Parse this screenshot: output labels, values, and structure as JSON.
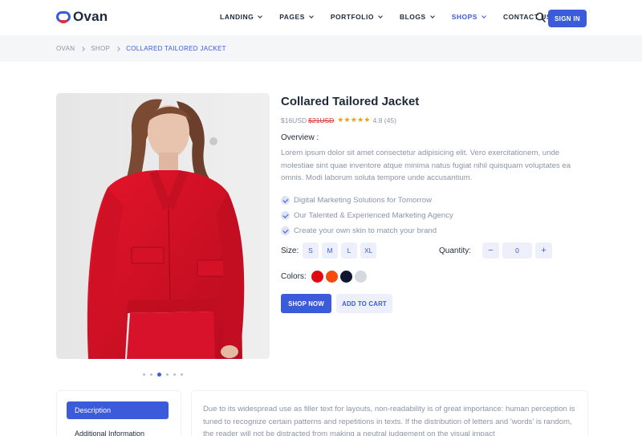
{
  "brand": {
    "name": "Ovan"
  },
  "nav": {
    "items": [
      {
        "label": "LANDING",
        "dropdown": true
      },
      {
        "label": "PAGES",
        "dropdown": true
      },
      {
        "label": "PORTFOLIO",
        "dropdown": true
      },
      {
        "label": "BLOGS",
        "dropdown": true
      },
      {
        "label": "SHOPS",
        "dropdown": true,
        "active": true
      },
      {
        "label": "CONTACT US",
        "dropdown": false
      }
    ],
    "search_icon": "search-icon",
    "signin_label": "SIGN IN"
  },
  "breadcrumb": {
    "items": [
      "OVAN",
      "SHOP"
    ],
    "current": "COLLARED TAILORED JACKET"
  },
  "product": {
    "title": "Collared Tailored Jacket",
    "price": "$16USD",
    "old_price": "$21USD",
    "stars": "★★★★★",
    "rating": "4.8 (45)",
    "overview_heading": "Overview :",
    "overview_text": "Lorem ipsum dolor sit amet consectetur adipisicing elit. Vero exercitationem, unde molestiae sint quae inventore atque minima natus fugiat nihil quisquam voluptates ea omnis. Modi laborum soluta tempore unde accusantium.",
    "features": [
      "Digital Marketing Solutions for Tomorrow",
      "Our Talented & Experienced Marketing Agency",
      "Create your own skin to match your brand"
    ],
    "size_label": "Size:",
    "sizes": [
      "S",
      "M",
      "L",
      "XL"
    ],
    "quantity_label": "Quantity:",
    "quantity": {
      "minus": "−",
      "value": "0",
      "plus": "+"
    },
    "colors_label": "Colors:",
    "colors": [
      "#e00b10",
      "#f44c0e",
      "#0f1730",
      "#d5d8de"
    ],
    "shop_now_label": "SHOP NOW",
    "add_to_cart_label": "ADD TO CART",
    "carousel": {
      "slides": 6,
      "active": 3
    }
  },
  "tabs": {
    "items": [
      "Description",
      "Additional Information"
    ],
    "active": "Description"
  },
  "description": {
    "text": "Due to its widespread use as filler text for layouts, non-readability is of great importance: human perception is tuned to recognize certain patterns and repetitions in texts. If the distribution of letters and 'words' is random, the reader will not be distracted from making a neutral judgement on the visual impact"
  },
  "colors": {
    "accent": "#3b5bdb",
    "accent_light": "#edf0fb",
    "muted_text": "#8b95a5",
    "breadcrumb_bg": "#f5f6f8"
  }
}
